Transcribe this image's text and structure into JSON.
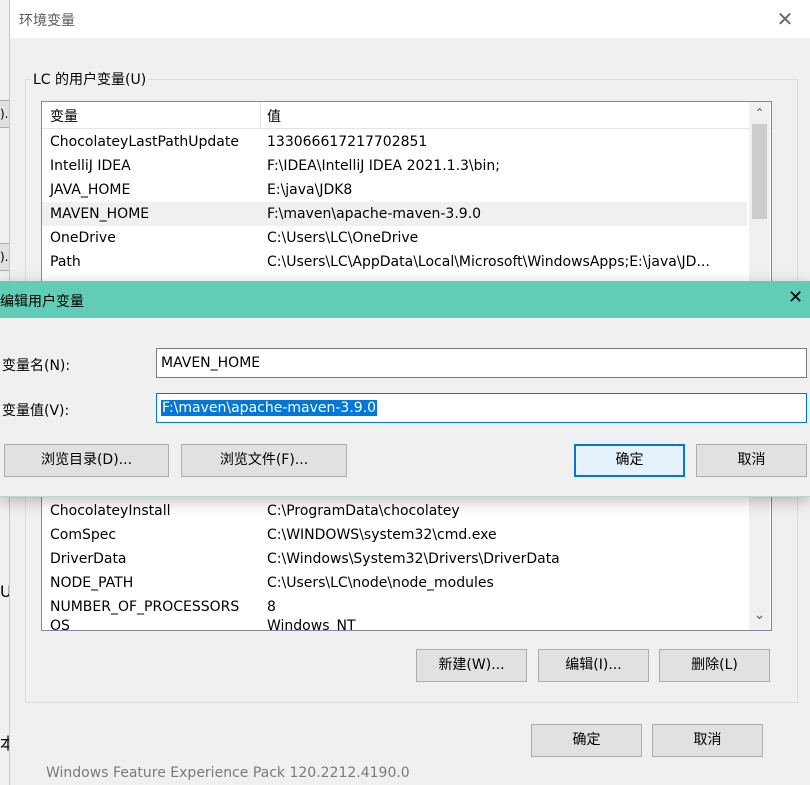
{
  "background": {
    "left_chars": ").",
    "left_chars2": ").",
    "left_char3": "U",
    "left_char4": "本",
    "bottom_text": "Windows Feature Experience Pack 120.2212.4190.0"
  },
  "env_window": {
    "title": "环境变量",
    "close_glyph": "✕",
    "user_group_label": "LC 的用户变量(U)",
    "user_vars": {
      "headers": [
        "变量",
        "值"
      ],
      "rows": [
        [
          "ChocolateyLastPathUpdate",
          "133066617217702851"
        ],
        [
          "IntelliJ IDEA",
          "F:\\IDEA\\IntelliJ IDEA 2021.1.3\\bin;"
        ],
        [
          "JAVA_HOME",
          "E:\\java\\JDK8"
        ],
        [
          "MAVEN_HOME",
          "F:\\maven\\apache-maven-3.9.0"
        ],
        [
          "OneDrive",
          "C:\\Users\\LC\\OneDrive"
        ],
        [
          "Path",
          "C:\\Users\\LC\\AppData\\Local\\Microsoft\\WindowsApps;E:\\java\\JD..."
        ]
      ]
    },
    "system_vars": {
      "rows": [
        [
          "ChocolateyInstall",
          "C:\\ProgramData\\chocolatey"
        ],
        [
          "ComSpec",
          "C:\\WINDOWS\\system32\\cmd.exe"
        ],
        [
          "DriverData",
          "C:\\Windows\\System32\\Drivers\\DriverData"
        ],
        [
          "NODE_PATH",
          "C:\\Users\\LC\\node\\node_modules"
        ],
        [
          "NUMBER_OF_PROCESSORS",
          "8"
        ],
        [
          "OS",
          "Windows_NT"
        ]
      ]
    },
    "buttons": {
      "new": "新建(W)...",
      "edit": "编辑(I)...",
      "delete": "删除(L)",
      "ok": "确定",
      "cancel": "取消"
    },
    "scroll_down": "⌄",
    "scroll_up": "⌃"
  },
  "edit_dialog": {
    "title": "编辑用户变量",
    "close_glyph": "✕",
    "name_label": "变量名(N):",
    "value_label": "变量值(V):",
    "name_value": "MAVEN_HOME",
    "value_value": "F:\\maven\\apache-maven-3.9.0",
    "buttons": {
      "browse_dir": "浏览目录(D)...",
      "browse_file": "浏览文件(F)...",
      "ok": "确定",
      "cancel": "取消"
    }
  }
}
